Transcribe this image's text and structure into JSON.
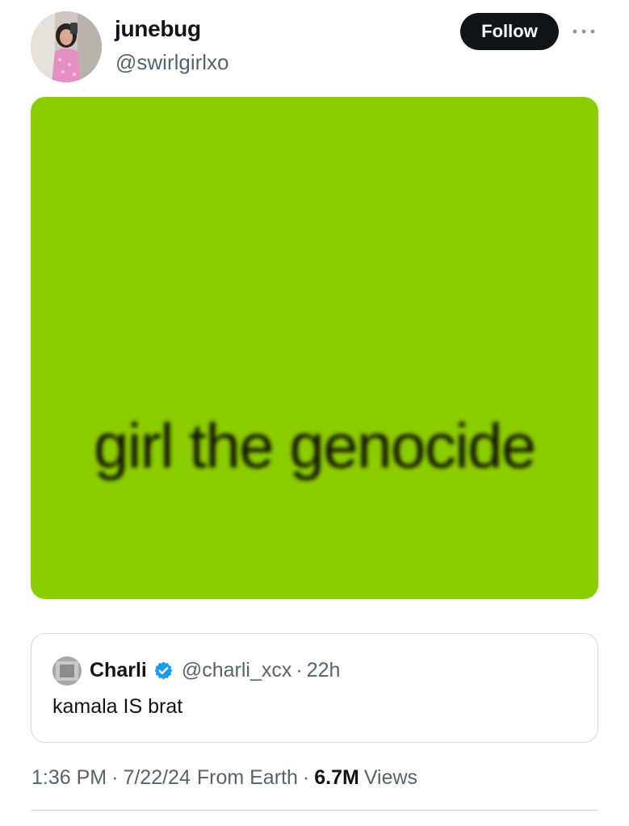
{
  "author": {
    "display_name": "junebug",
    "handle": "@swirlgirlxo",
    "avatar_icon": "profile-photo"
  },
  "actions": {
    "follow_label": "Follow",
    "more_icon": "more-horizontal-icon"
  },
  "media": {
    "background_color": "#8ccd00",
    "text": "girl the genocide"
  },
  "quoted_tweet": {
    "name": "Charli",
    "verified": true,
    "verified_color": "#1d9bf0",
    "handle": "@charli_xcx",
    "separator": "·",
    "time": "22h",
    "text": "kamala IS brat"
  },
  "meta": {
    "time": "1:36 PM",
    "separator": "·",
    "date": "7/22/24",
    "location": "From Earth",
    "views_count": "6.7M",
    "views_label": "Views"
  }
}
